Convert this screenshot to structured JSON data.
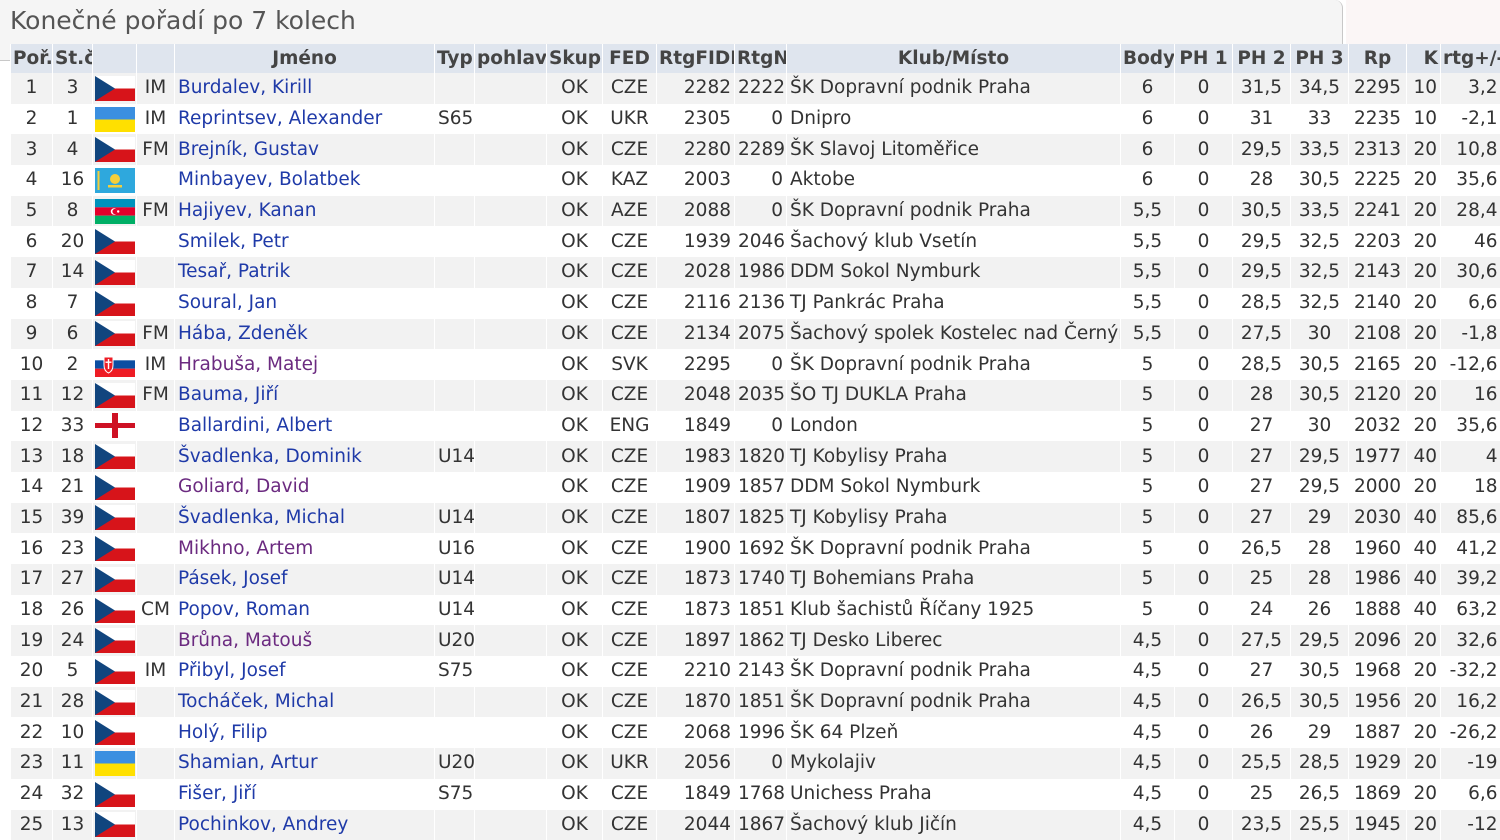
{
  "page": {
    "title": "Konečné pořadí po 7 kolech"
  },
  "table": {
    "headers": {
      "rank": "Poř.",
      "start_no": "St.č.",
      "name": "Jméno",
      "type": "Typ",
      "gender": "pohlaví",
      "group": "Skup.",
      "fed": "FED",
      "rtg_fide": "RtgFIDE",
      "rtg_n": "RtgN",
      "club": "Klub/Místo",
      "points": "Body",
      "ph1": "PH 1",
      "ph2": "PH 2",
      "ph3": "PH 3",
      "rp": "Rp",
      "k": "K",
      "rtg_change": "rtg+/-"
    },
    "rows": [
      {
        "rank": "1",
        "start_no": "3",
        "flag": "CZE",
        "title": "IM",
        "name": "Burdalev, Kirill",
        "visited": false,
        "type": "",
        "gender": "",
        "group": "OK",
        "fed": "CZE",
        "rtg_fide": "2282",
        "rtg_n": "2222",
        "club": "ŠK Dopravní podnik Praha",
        "points": "6",
        "ph1": "0",
        "ph2": "31,5",
        "ph3": "34,5",
        "rp": "2295",
        "k": "10",
        "rtg_change": "3,2"
      },
      {
        "rank": "2",
        "start_no": "1",
        "flag": "UKR",
        "title": "IM",
        "name": "Reprintsev, Alexander",
        "visited": false,
        "type": "S65",
        "gender": "",
        "group": "OK",
        "fed": "UKR",
        "rtg_fide": "2305",
        "rtg_n": "0",
        "club": "Dnipro",
        "points": "6",
        "ph1": "0",
        "ph2": "31",
        "ph3": "33",
        "rp": "2235",
        "k": "10",
        "rtg_change": "-2,1"
      },
      {
        "rank": "3",
        "start_no": "4",
        "flag": "CZE",
        "title": "FM",
        "name": "Brejník, Gustav",
        "visited": false,
        "type": "",
        "gender": "",
        "group": "OK",
        "fed": "CZE",
        "rtg_fide": "2280",
        "rtg_n": "2289",
        "club": "ŠK Slavoj Litoměřice",
        "points": "6",
        "ph1": "0",
        "ph2": "29,5",
        "ph3": "33,5",
        "rp": "2313",
        "k": "20",
        "rtg_change": "10,8"
      },
      {
        "rank": "4",
        "start_no": "16",
        "flag": "KAZ",
        "title": "",
        "name": "Minbayev, Bolatbek",
        "visited": false,
        "type": "",
        "gender": "",
        "group": "OK",
        "fed": "KAZ",
        "rtg_fide": "2003",
        "rtg_n": "0",
        "club": "Aktobe",
        "points": "6",
        "ph1": "0",
        "ph2": "28",
        "ph3": "30,5",
        "rp": "2225",
        "k": "20",
        "rtg_change": "35,6"
      },
      {
        "rank": "5",
        "start_no": "8",
        "flag": "AZE",
        "title": "FM",
        "name": "Hajiyev, Kanan",
        "visited": false,
        "type": "",
        "gender": "",
        "group": "OK",
        "fed": "AZE",
        "rtg_fide": "2088",
        "rtg_n": "0",
        "club": "ŠK Dopravní podnik Praha",
        "points": "5,5",
        "ph1": "0",
        "ph2": "30,5",
        "ph3": "33,5",
        "rp": "2241",
        "k": "20",
        "rtg_change": "28,4"
      },
      {
        "rank": "6",
        "start_no": "20",
        "flag": "CZE",
        "title": "",
        "name": "Smilek, Petr",
        "visited": false,
        "type": "",
        "gender": "",
        "group": "OK",
        "fed": "CZE",
        "rtg_fide": "1939",
        "rtg_n": "2046",
        "club": "Šachový klub Vsetín",
        "points": "5,5",
        "ph1": "0",
        "ph2": "29,5",
        "ph3": "32,5",
        "rp": "2203",
        "k": "20",
        "rtg_change": "46"
      },
      {
        "rank": "7",
        "start_no": "14",
        "flag": "CZE",
        "title": "",
        "name": "Tesař, Patrik",
        "visited": false,
        "type": "",
        "gender": "",
        "group": "OK",
        "fed": "CZE",
        "rtg_fide": "2028",
        "rtg_n": "1986",
        "club": "DDM Sokol Nymburk",
        "points": "5,5",
        "ph1": "0",
        "ph2": "29,5",
        "ph3": "32,5",
        "rp": "2143",
        "k": "20",
        "rtg_change": "30,6"
      },
      {
        "rank": "8",
        "start_no": "7",
        "flag": "CZE",
        "title": "",
        "name": "Soural, Jan",
        "visited": false,
        "type": "",
        "gender": "",
        "group": "OK",
        "fed": "CZE",
        "rtg_fide": "2116",
        "rtg_n": "2136",
        "club": "TJ Pankrác Praha",
        "points": "5,5",
        "ph1": "0",
        "ph2": "28,5",
        "ph3": "32,5",
        "rp": "2140",
        "k": "20",
        "rtg_change": "6,6"
      },
      {
        "rank": "9",
        "start_no": "6",
        "flag": "CZE",
        "title": "FM",
        "name": "Hába, Zdeněk",
        "visited": false,
        "type": "",
        "gender": "",
        "group": "OK",
        "fed": "CZE",
        "rtg_fide": "2134",
        "rtg_n": "2075",
        "club": "Šachový spolek Kostelec nad Černými",
        "points": "5,5",
        "ph1": "0",
        "ph2": "27,5",
        "ph3": "30",
        "rp": "2108",
        "k": "20",
        "rtg_change": "-1,8"
      },
      {
        "rank": "10",
        "start_no": "2",
        "flag": "SVK",
        "title": "IM",
        "name": "Hrabuša, Matej",
        "visited": true,
        "type": "",
        "gender": "",
        "group": "OK",
        "fed": "SVK",
        "rtg_fide": "2295",
        "rtg_n": "0",
        "club": "ŠK Dopravní podnik Praha",
        "points": "5",
        "ph1": "0",
        "ph2": "28,5",
        "ph3": "30,5",
        "rp": "2165",
        "k": "20",
        "rtg_change": "-12,6"
      },
      {
        "rank": "11",
        "start_no": "12",
        "flag": "CZE",
        "title": "FM",
        "name": "Bauma, Jiří",
        "visited": false,
        "type": "",
        "gender": "",
        "group": "OK",
        "fed": "CZE",
        "rtg_fide": "2048",
        "rtg_n": "2035",
        "club": "ŠO TJ DUKLA Praha",
        "points": "5",
        "ph1": "0",
        "ph2": "28",
        "ph3": "30,5",
        "rp": "2120",
        "k": "20",
        "rtg_change": "16"
      },
      {
        "rank": "12",
        "start_no": "33",
        "flag": "ENG",
        "title": "",
        "name": "Ballardini, Albert",
        "visited": false,
        "type": "",
        "gender": "",
        "group": "OK",
        "fed": "ENG",
        "rtg_fide": "1849",
        "rtg_n": "0",
        "club": "London",
        "points": "5",
        "ph1": "0",
        "ph2": "27",
        "ph3": "30",
        "rp": "2032",
        "k": "20",
        "rtg_change": "35,6"
      },
      {
        "rank": "13",
        "start_no": "18",
        "flag": "CZE",
        "title": "",
        "name": "Švadlenka, Dominik",
        "visited": false,
        "type": "U14",
        "gender": "",
        "group": "OK",
        "fed": "CZE",
        "rtg_fide": "1983",
        "rtg_n": "1820",
        "club": "TJ Kobylisy Praha",
        "points": "5",
        "ph1": "0",
        "ph2": "27",
        "ph3": "29,5",
        "rp": "1977",
        "k": "40",
        "rtg_change": "4"
      },
      {
        "rank": "14",
        "start_no": "21",
        "flag": "CZE",
        "title": "",
        "name": "Goliard, David",
        "visited": true,
        "type": "",
        "gender": "",
        "group": "OK",
        "fed": "CZE",
        "rtg_fide": "1909",
        "rtg_n": "1857",
        "club": "DDM Sokol Nymburk",
        "points": "5",
        "ph1": "0",
        "ph2": "27",
        "ph3": "29,5",
        "rp": "2000",
        "k": "20",
        "rtg_change": "18"
      },
      {
        "rank": "15",
        "start_no": "39",
        "flag": "CZE",
        "title": "",
        "name": "Švadlenka, Michal",
        "visited": false,
        "type": "U14",
        "gender": "",
        "group": "OK",
        "fed": "CZE",
        "rtg_fide": "1807",
        "rtg_n": "1825",
        "club": "TJ Kobylisy Praha",
        "points": "5",
        "ph1": "0",
        "ph2": "27",
        "ph3": "29",
        "rp": "2030",
        "k": "40",
        "rtg_change": "85,6"
      },
      {
        "rank": "16",
        "start_no": "23",
        "flag": "CZE",
        "title": "",
        "name": "Mikhno, Artem",
        "visited": true,
        "type": "U16",
        "gender": "",
        "group": "OK",
        "fed": "CZE",
        "rtg_fide": "1900",
        "rtg_n": "1692",
        "club": "ŠK Dopravní podnik Praha",
        "points": "5",
        "ph1": "0",
        "ph2": "26,5",
        "ph3": "28",
        "rp": "1960",
        "k": "40",
        "rtg_change": "41,2"
      },
      {
        "rank": "17",
        "start_no": "27",
        "flag": "CZE",
        "title": "",
        "name": "Pásek, Josef",
        "visited": false,
        "type": "U14",
        "gender": "",
        "group": "OK",
        "fed": "CZE",
        "rtg_fide": "1873",
        "rtg_n": "1740",
        "club": "TJ Bohemians Praha",
        "points": "5",
        "ph1": "0",
        "ph2": "25",
        "ph3": "28",
        "rp": "1986",
        "k": "40",
        "rtg_change": "39,2"
      },
      {
        "rank": "18",
        "start_no": "26",
        "flag": "CZE",
        "title": "CM",
        "name": "Popov, Roman",
        "visited": false,
        "type": "U14",
        "gender": "",
        "group": "OK",
        "fed": "CZE",
        "rtg_fide": "1873",
        "rtg_n": "1851",
        "club": "Klub šachistů Říčany 1925",
        "points": "5",
        "ph1": "0",
        "ph2": "24",
        "ph3": "26",
        "rp": "1888",
        "k": "40",
        "rtg_change": "63,2"
      },
      {
        "rank": "19",
        "start_no": "24",
        "flag": "CZE",
        "title": "",
        "name": "Brůna, Matouš",
        "visited": true,
        "type": "U20",
        "gender": "",
        "group": "OK",
        "fed": "CZE",
        "rtg_fide": "1897",
        "rtg_n": "1862",
        "club": "TJ Desko Liberec",
        "points": "4,5",
        "ph1": "0",
        "ph2": "27,5",
        "ph3": "29,5",
        "rp": "2096",
        "k": "20",
        "rtg_change": "32,6"
      },
      {
        "rank": "20",
        "start_no": "5",
        "flag": "CZE",
        "title": "IM",
        "name": "Přibyl, Josef",
        "visited": false,
        "type": "S75",
        "gender": "",
        "group": "OK",
        "fed": "CZE",
        "rtg_fide": "2210",
        "rtg_n": "2143",
        "club": "ŠK Dopravní podnik Praha",
        "points": "4,5",
        "ph1": "0",
        "ph2": "27",
        "ph3": "30,5",
        "rp": "1968",
        "k": "20",
        "rtg_change": "-32,2"
      },
      {
        "rank": "21",
        "start_no": "28",
        "flag": "CZE",
        "title": "",
        "name": "Tocháček, Michal",
        "visited": false,
        "type": "",
        "gender": "",
        "group": "OK",
        "fed": "CZE",
        "rtg_fide": "1870",
        "rtg_n": "1851",
        "club": "ŠK Dopravní podnik Praha",
        "points": "4,5",
        "ph1": "0",
        "ph2": "26,5",
        "ph3": "30,5",
        "rp": "1956",
        "k": "20",
        "rtg_change": "16,2"
      },
      {
        "rank": "22",
        "start_no": "10",
        "flag": "CZE",
        "title": "",
        "name": "Holý, Filip",
        "visited": false,
        "type": "",
        "gender": "",
        "group": "OK",
        "fed": "CZE",
        "rtg_fide": "2068",
        "rtg_n": "1996",
        "club": "ŠK 64 Plzeň",
        "points": "4,5",
        "ph1": "0",
        "ph2": "26",
        "ph3": "29",
        "rp": "1887",
        "k": "20",
        "rtg_change": "-26,2"
      },
      {
        "rank": "23",
        "start_no": "11",
        "flag": "UKR",
        "title": "",
        "name": "Shamian, Artur",
        "visited": false,
        "type": "U20",
        "gender": "",
        "group": "OK",
        "fed": "UKR",
        "rtg_fide": "2056",
        "rtg_n": "0",
        "club": "Mykolajiv",
        "points": "4,5",
        "ph1": "0",
        "ph2": "25,5",
        "ph3": "28,5",
        "rp": "1929",
        "k": "20",
        "rtg_change": "-19"
      },
      {
        "rank": "24",
        "start_no": "32",
        "flag": "CZE",
        "title": "",
        "name": "Fišer, Jiří",
        "visited": false,
        "type": "S75",
        "gender": "",
        "group": "OK",
        "fed": "CZE",
        "rtg_fide": "1849",
        "rtg_n": "1768",
        "club": "Unichess Praha",
        "points": "4,5",
        "ph1": "0",
        "ph2": "25",
        "ph3": "26,5",
        "rp": "1869",
        "k": "20",
        "rtg_change": "6,6"
      },
      {
        "rank": "25",
        "start_no": "13",
        "flag": "CZE",
        "title": "",
        "name": "Pochinkov, Andrey",
        "visited": false,
        "type": "",
        "gender": "",
        "group": "OK",
        "fed": "CZE",
        "rtg_fide": "2044",
        "rtg_n": "1867",
        "club": "Šachový klub Jičín",
        "points": "4,5",
        "ph1": "0",
        "ph2": "23,5",
        "ph3": "25,5",
        "rp": "1945",
        "k": "20",
        "rtg_change": "-12"
      }
    ]
  },
  "colors": {
    "header_bg": "#dfe5ee",
    "link": "#1f3aa8",
    "visited_link": "#6b2a80",
    "row_alt": "#f2f2f2"
  }
}
